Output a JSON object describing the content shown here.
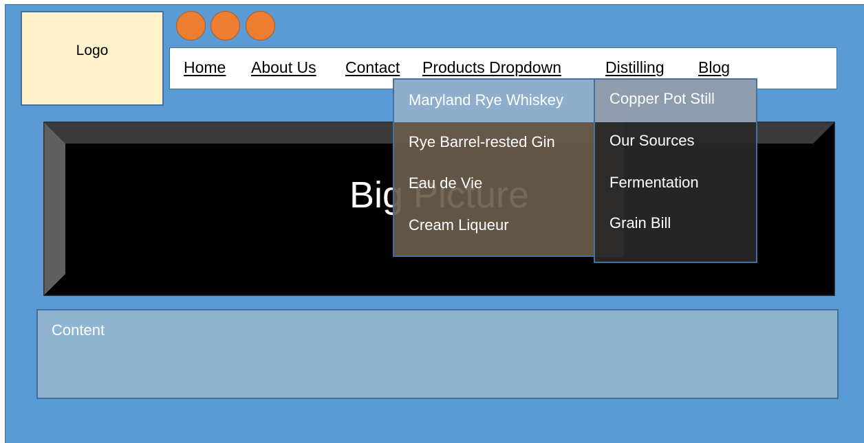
{
  "logo": {
    "label": "Logo"
  },
  "social_icons": [
    "social-circle-icon",
    "social-circle-icon",
    "social-circle-icon"
  ],
  "nav": {
    "items": [
      {
        "label": "Home"
      },
      {
        "label": "About Us"
      },
      {
        "label": "Contact"
      },
      {
        "label": "Products Dropdown"
      },
      {
        "label": "Distilling"
      },
      {
        "label": "Blog"
      }
    ]
  },
  "hero": {
    "title": "Big Picture"
  },
  "products_dropdown": {
    "items": [
      {
        "label": "Maryland Rye Whiskey"
      },
      {
        "label": "Rye Barrel-rested Gin"
      },
      {
        "label": "Eau de Vie"
      },
      {
        "label": "Cream Liqueur"
      }
    ]
  },
  "distilling_dropdown": {
    "items": [
      {
        "label": "Copper Pot Still"
      },
      {
        "label": "Our Sources"
      },
      {
        "label": "Fermentation"
      },
      {
        "label": "Grain Bill"
      }
    ]
  },
  "content": {
    "label": "Content"
  },
  "colors": {
    "background": "#5b9bd5",
    "logo_fill": "#fff2cc",
    "social_fill": "#ed7d31",
    "content_fill": "#8fb4d0",
    "border": "#41719c"
  }
}
